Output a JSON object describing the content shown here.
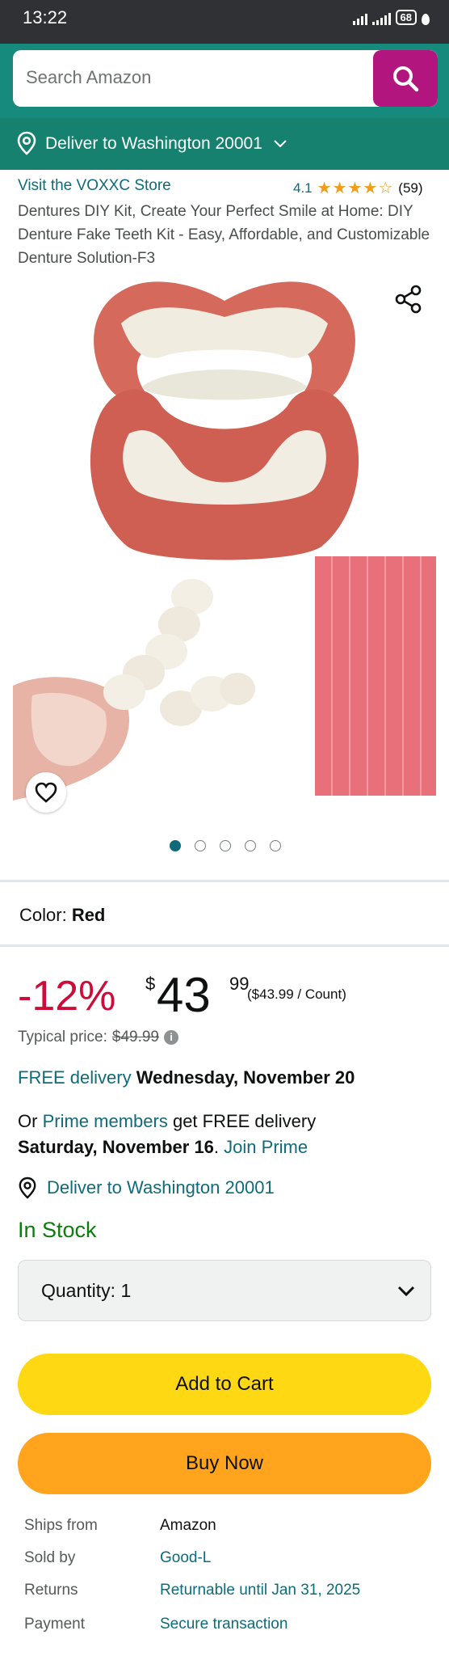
{
  "status_bar": {
    "time": "13:22",
    "battery": "68"
  },
  "search": {
    "placeholder": "Search Amazon"
  },
  "deliver": {
    "label": "Deliver to Washington 20001"
  },
  "product": {
    "store": "Visit the VOXXC Store",
    "rating": "4.1",
    "stars": "★★★★☆",
    "rating_count": "(59)",
    "title": "Dentures DIY Kit, Create Your Perfect Smile at Home: DIY Denture Fake Teeth Kit - Easy, Affordable, and Customizable Denture Solution-F3",
    "image_count": 5,
    "active_image": 1
  },
  "color": {
    "label": "Color:",
    "value": "Red"
  },
  "price": {
    "discount": "-12%",
    "symbol": "$",
    "whole": "43",
    "fraction": "99",
    "unit": "($43.99 / Count)",
    "typical_label": "Typical price:",
    "typical_value": "$49.99"
  },
  "delivery": {
    "free_link": "FREE delivery",
    "free_date": "Wednesday, November 20",
    "prime_prefix": "Or",
    "prime_link": "Prime members",
    "prime_mid": "get FREE delivery",
    "prime_date": "Saturday, November 16",
    "prime_dot": ".",
    "join_prime": "Join Prime",
    "deliver_to": "Deliver to Washington 20001"
  },
  "stock": "In Stock",
  "quantity": {
    "label": "Quantity:",
    "value": "1"
  },
  "buttons": {
    "add_to_cart": "Add to Cart",
    "buy_now": "Buy Now"
  },
  "info": [
    {
      "key": "Ships from",
      "value": "Amazon",
      "link": false
    },
    {
      "key": "Sold by",
      "value": "Good-L",
      "link": true
    },
    {
      "key": "Returns",
      "value": "Returnable until Jan 31, 2025",
      "link": true
    },
    {
      "key": "Payment",
      "value": "Secure transaction",
      "link": true
    }
  ],
  "colors": {
    "header": "#168a7c",
    "search_button": "#b3157f",
    "link": "#0f6b7a",
    "discount": "#cc0c39",
    "in_stock": "#0f7b0f",
    "add_to_cart": "#ffd814",
    "buy_now": "#ffa41c",
    "star": "#f29c17"
  }
}
